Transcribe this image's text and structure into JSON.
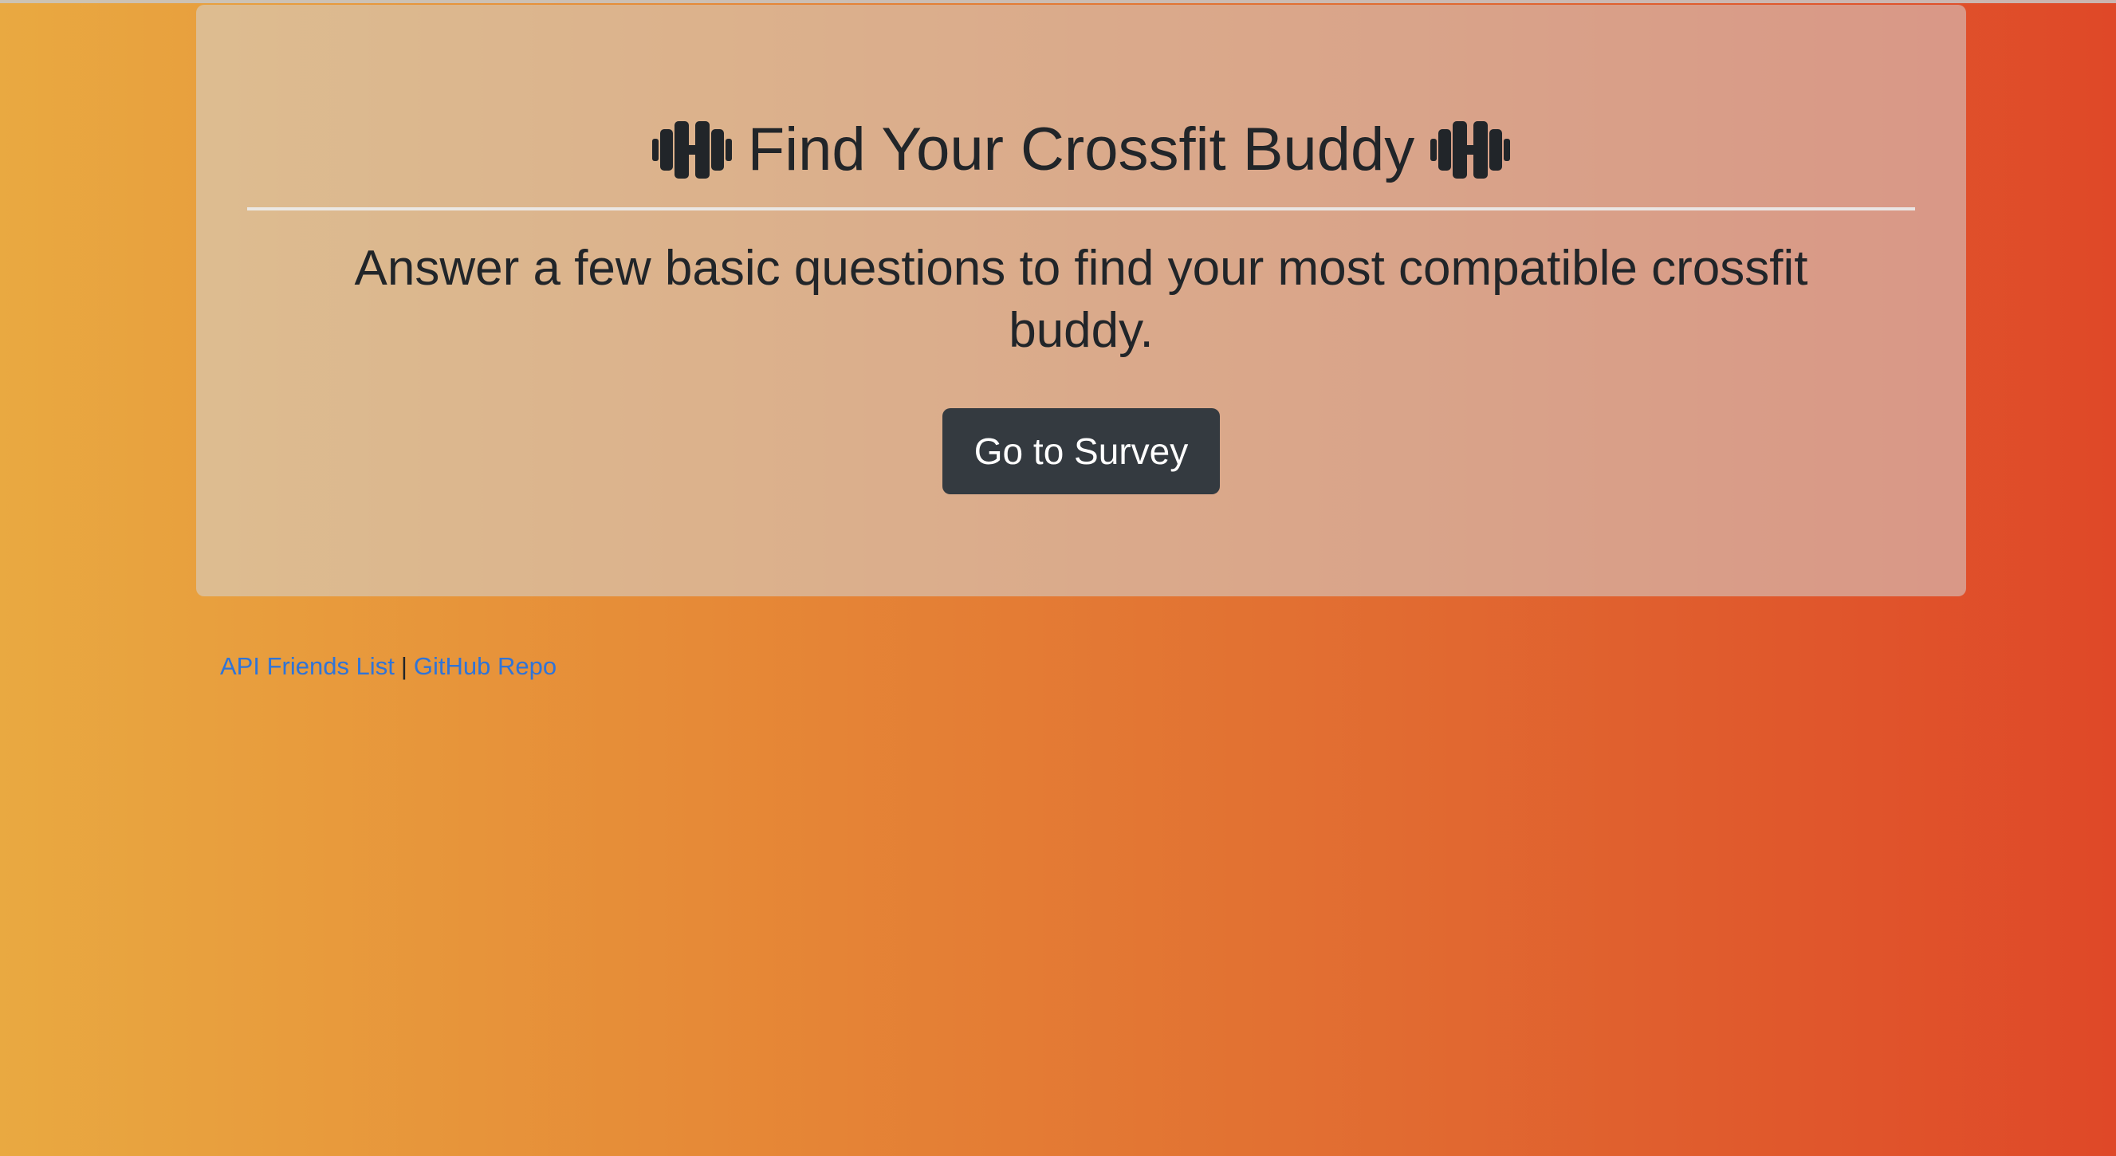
{
  "hero": {
    "title": "Find Your Crossfit Buddy",
    "subtitle": "Answer a few basic questions to find your most compatible crossfit buddy.",
    "button_label": "Go to Survey",
    "left_icon": "dumbbell-icon",
    "right_icon": "dumbbell-icon"
  },
  "footer": {
    "links": [
      {
        "label": "API Friends List"
      },
      {
        "label": "GitHub Repo"
      }
    ],
    "separator": "|"
  },
  "colors": {
    "background_left": "#e9a941",
    "background_right": "#df4828",
    "panel": "rgba(211, 211, 211, 0.55)",
    "button": "#343a40",
    "link": "#2f74d8"
  }
}
